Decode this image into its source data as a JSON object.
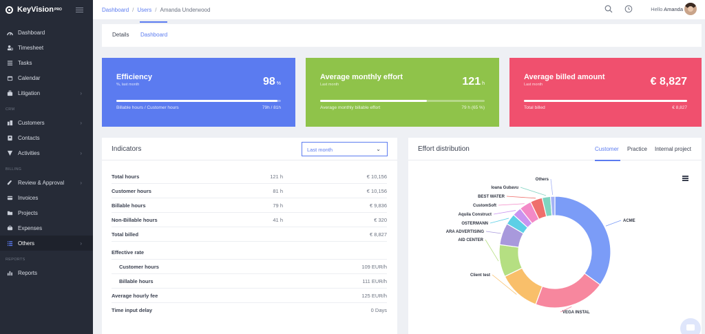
{
  "brand": {
    "name": "KeyVision",
    "badge": "PRO"
  },
  "sidebar": {
    "items": [
      {
        "label": "Dashboard",
        "icon": "dashboard-icon"
      },
      {
        "label": "Timesheet",
        "icon": "timesheet-icon"
      },
      {
        "label": "Tasks",
        "icon": "tasks-icon"
      },
      {
        "label": "Calendar",
        "icon": "calendar-icon"
      },
      {
        "label": "Litigation",
        "icon": "litigation-icon",
        "has_arrow": true
      }
    ],
    "crm_section": "CRM",
    "crm_items": [
      {
        "label": "Customers",
        "has_arrow": true
      },
      {
        "label": "Contacts"
      },
      {
        "label": "Activities",
        "has_arrow": true
      }
    ],
    "billing_section": "BILLING",
    "billing_items": [
      {
        "label": "Review & Approval",
        "has_arrow": true
      },
      {
        "label": "Invoices"
      },
      {
        "label": "Projects"
      },
      {
        "label": "Expenses"
      },
      {
        "label": "Others",
        "has_arrow": true,
        "active": true
      }
    ],
    "reports_section": "REPORTS",
    "reports_items": [
      {
        "label": "Reports"
      }
    ]
  },
  "breadcrumb": {
    "items": [
      "Dashboard",
      "Users",
      "Amanda Underwood"
    ]
  },
  "topbar": {
    "hello": "Hello",
    "user_name": "Amanda"
  },
  "tabs": [
    "Details",
    "Dashboard"
  ],
  "active_tab": "Dashboard",
  "kpis": [
    {
      "title": "Efficiency",
      "subtitle": "%, last month",
      "value": "98",
      "unit": "%",
      "progress": 0.98,
      "footer_left": "Billable hours / Customer hours",
      "footer_right": "79h / 81h",
      "color": "#5b7bf0"
    },
    {
      "title": "Average monthly effort",
      "subtitle": "Last month",
      "value": "121",
      "unit": "h",
      "progress": 0.65,
      "footer_left": "Average monthly billable effort",
      "footer_right": "79 h (65 %)",
      "color": "#8fc34a"
    },
    {
      "title": "Average billed amount",
      "subtitle": "Last month",
      "value": "€ 8,827",
      "unit": "",
      "progress": 1.0,
      "footer_left": "Total billed",
      "footer_right": "€ 8,827",
      "color": "#f0506e"
    }
  ],
  "indicators": {
    "title": "Indicators",
    "period": "Last month",
    "rows": [
      {
        "label": "Total hours",
        "hours": "121 h",
        "amount": "€ 10,156"
      },
      {
        "label": "Customer hours",
        "hours": "81 h",
        "amount": "€ 10,156"
      },
      {
        "label": "Billable hours",
        "hours": "79 h",
        "amount": "€ 9,836"
      },
      {
        "label": "Non-Billable hours",
        "hours": "41 h",
        "amount": "€ 320"
      },
      {
        "label": "Total billed",
        "hours": "",
        "amount": "€ 8,827"
      }
    ],
    "rate_title": "Effective rate",
    "rate_rows": [
      {
        "label": "Customer hours",
        "value": "109 EUR/h"
      },
      {
        "label": "Billable hours",
        "value": "111 EUR/h"
      }
    ],
    "extra_rows": [
      {
        "label": "Average hourly fee",
        "value": "125 EUR/h"
      },
      {
        "label": "Time input delay",
        "value": "0 Days"
      }
    ]
  },
  "effort": {
    "title": "Effort distribution",
    "tabs": [
      "Customer",
      "Practice",
      "Internal project"
    ],
    "active_tab": "Customer"
  },
  "chart_data": {
    "type": "pie",
    "donut": true,
    "categories": [
      "ACME",
      "VEGA INSTAL",
      "Client test",
      "AID CENTER",
      "ARA ADVERTISING",
      "OSTERMANN",
      "Aquila Construct",
      "CustomSoft",
      "BEST WATER",
      "Ioana Gubavu",
      "Others"
    ],
    "values": [
      33,
      19.5,
      11.5,
      8.8,
      6,
      3,
      2.5,
      3.3,
      3.3,
      2.3,
      1.2
    ],
    "colors": [
      "#7b9cf7",
      "#f7879e",
      "#f9bf6a",
      "#b5df82",
      "#a899dc",
      "#5ccfe6",
      "#c994f0",
      "#f389c7",
      "#ef6f6c",
      "#7fd3c0",
      "#a4b2f6"
    ]
  }
}
